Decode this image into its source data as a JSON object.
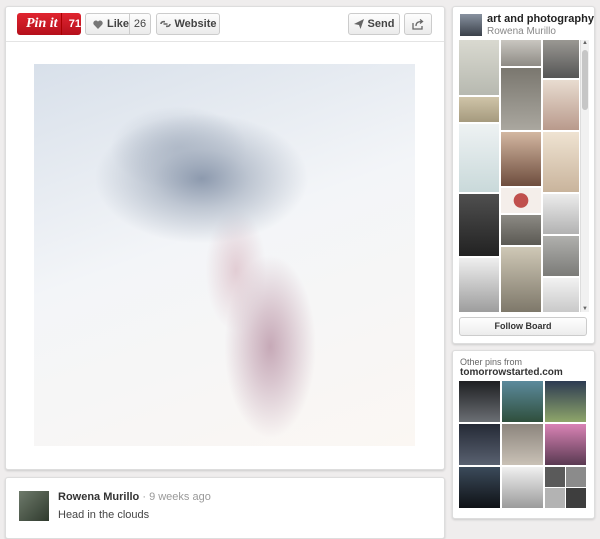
{
  "toolbar": {
    "pinit_label": "Pin it",
    "pinit_count": "71",
    "like_label": "Like",
    "like_count": "26",
    "website_label": "Website",
    "send_label": "Send"
  },
  "comment": {
    "author": "Rowena Murillo",
    "time": "· 9 weeks ago",
    "text": "Head in the clouds"
  },
  "board": {
    "title": "art and photography",
    "owner": "Rowena Murillo",
    "follow_label": "Follow Board"
  },
  "other_pins": {
    "heading": "Other pins from",
    "source": "tomorrowstarted.com"
  },
  "colors": {
    "pinit_red": "#cb1f27",
    "background": "#efeded"
  },
  "icons": [
    "heart-icon",
    "website-link-icon",
    "send-arrow-icon",
    "share-icon"
  ]
}
